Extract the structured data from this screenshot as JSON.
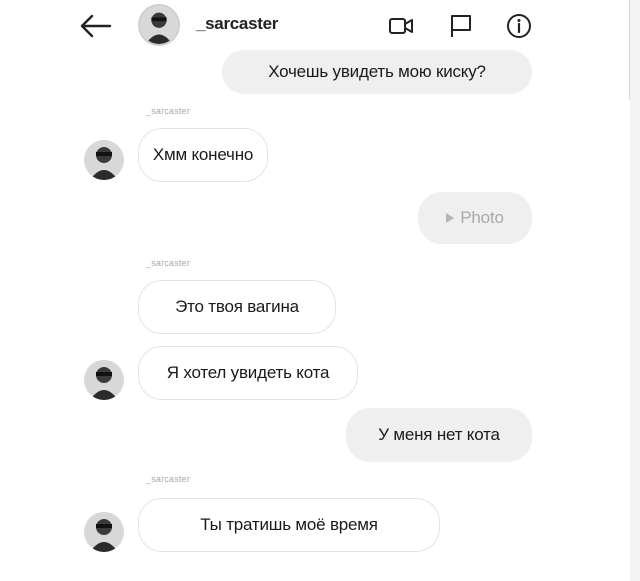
{
  "header": {
    "username": "_sarcaster",
    "icons": [
      "back-arrow-icon",
      "video-call-icon",
      "flag-icon",
      "info-icon"
    ]
  },
  "messages": [
    {
      "direction": "outgoing",
      "text": "Хочешь увидеть мою киску?"
    },
    {
      "direction": "incoming",
      "sender": "_sarcaster",
      "text": "Хмм конечно"
    },
    {
      "direction": "outgoing",
      "type": "photo",
      "text": "Photo"
    },
    {
      "direction": "incoming",
      "sender": "_sarcaster",
      "text": "Это твоя вагина"
    },
    {
      "direction": "incoming",
      "text": "Я хотел увидеть кота"
    },
    {
      "direction": "outgoing",
      "text": "У меня нет кота"
    },
    {
      "direction": "incoming",
      "sender": "_sarcaster",
      "text": "Ты тратишь моё время"
    }
  ]
}
